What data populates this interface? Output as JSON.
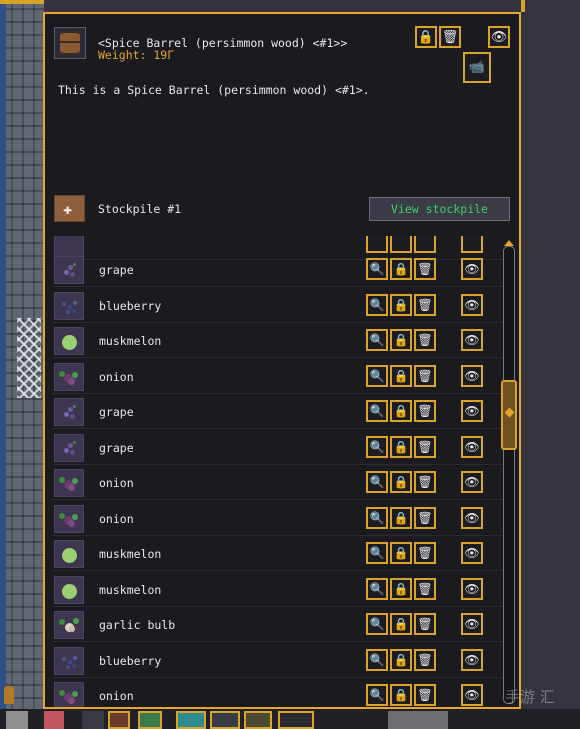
{
  "item": {
    "title": "<Spice Barrel (persimmon wood) <#1>>",
    "weight": "Weight: 19Γ",
    "description": "This is a Spice Barrel (persimmon wood) <#1>.",
    "icon": "barrel-icon"
  },
  "header_buttons": {
    "lock_icon": "🔒",
    "trash_icon": "🗑",
    "eye_icon": "👁",
    "camera_icon": "📹"
  },
  "stockpile": {
    "label": "Stockpile #1",
    "view_label": "View stockpile",
    "view_color": "#3fd06a"
  },
  "row_icons": {
    "magnify": "🔍",
    "lock": "🔒",
    "trash": "🗑",
    "eye": "👁"
  },
  "rows": [
    {
      "name": "grape",
      "kind": "grape"
    },
    {
      "name": "blueberry",
      "kind": "blueberry"
    },
    {
      "name": "muskmelon",
      "kind": "muskmelon"
    },
    {
      "name": "onion",
      "kind": "onion"
    },
    {
      "name": "grape",
      "kind": "grape"
    },
    {
      "name": "grape",
      "kind": "grape"
    },
    {
      "name": "onion",
      "kind": "onion"
    },
    {
      "name": "onion",
      "kind": "onion"
    },
    {
      "name": "muskmelon",
      "kind": "muskmelon"
    },
    {
      "name": "muskmelon",
      "kind": "muskmelon"
    },
    {
      "name": "garlic bulb",
      "kind": "garlic"
    },
    {
      "name": "blueberry",
      "kind": "blueberry"
    },
    {
      "name": "onion",
      "kind": "onion"
    }
  ],
  "watermark": "手游 汇",
  "colors": {
    "accent": "#d9a42a",
    "panel_bg": "#1a1a1f",
    "weight": "#e3a52a"
  }
}
